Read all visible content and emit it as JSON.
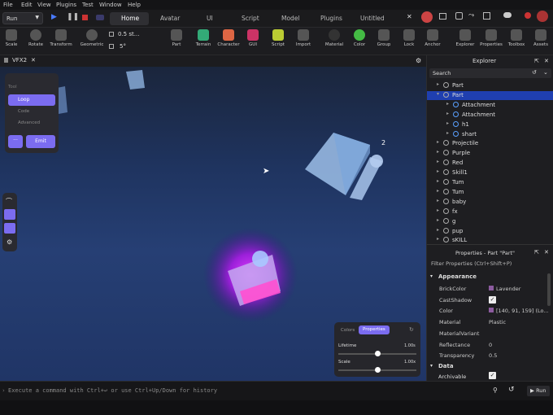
{
  "menu": [
    "File",
    "Edit",
    "View",
    "Plugins",
    "Test",
    "Window",
    "Help"
  ],
  "run_label": "Run",
  "tabs": [
    "Home",
    "Avatar",
    "UI",
    "Script",
    "Model",
    "Plugins",
    "Untitled"
  ],
  "ribbon": {
    "scale": "Scale",
    "rotate": "Rotate",
    "transform": "Transform",
    "geometric": "Geometric",
    "step": "0.5 st...",
    "angle": "5°",
    "part": "Part",
    "terrain": "Terrain",
    "character": "Character",
    "gui": "GUI",
    "script": "Script",
    "import": "Import",
    "material": "Material",
    "color": "Color",
    "group": "Group",
    "lock": "Lock",
    "anchor": "Anchor",
    "explorer": "Explorer",
    "properties": "Properties",
    "toolbox": "Toolbox",
    "assets": "Assets"
  },
  "viewport_tab": "VFX2",
  "vfx_panel": {
    "tool": "Tool",
    "loop": "Loop",
    "code": "Code",
    "advanced": "Advanced",
    "emit": "Emit",
    "more": "···"
  },
  "part_label": "2",
  "props_overlay": {
    "colors": "Colors",
    "properties": "Properties",
    "lifetime": "Lifetime",
    "lifetime_val": "1.00s",
    "scale": "Scale",
    "scale_val": "1.00x"
  },
  "explorer": {
    "title": "Explorer",
    "search": "Search",
    "items": [
      {
        "label": "Part",
        "depth": 1,
        "sel": false
      },
      {
        "label": "Part",
        "depth": 1,
        "sel": true
      },
      {
        "label": "Attachment",
        "depth": 2,
        "sel": false
      },
      {
        "label": "Attachment",
        "depth": 2,
        "sel": false
      },
      {
        "label": "h1",
        "depth": 2,
        "sel": false
      },
      {
        "label": "shart",
        "depth": 2,
        "sel": false
      },
      {
        "label": "Projectile",
        "depth": 1,
        "sel": false
      },
      {
        "label": "Purple",
        "depth": 1,
        "sel": false
      },
      {
        "label": "Red",
        "depth": 1,
        "sel": false
      },
      {
        "label": "Skill1",
        "depth": 1,
        "sel": false
      },
      {
        "label": "Tum",
        "depth": 1,
        "sel": false
      },
      {
        "label": "Tum",
        "depth": 1,
        "sel": false
      },
      {
        "label": "baby",
        "depth": 1,
        "sel": false
      },
      {
        "label": "fx",
        "depth": 1,
        "sel": false
      },
      {
        "label": "g",
        "depth": 1,
        "sel": false
      },
      {
        "label": "pup",
        "depth": 1,
        "sel": false
      },
      {
        "label": "sKILL",
        "depth": 1,
        "sel": false
      }
    ]
  },
  "properties": {
    "title": "Properties - Part \"Part\"",
    "filter": "Filter Properties (Ctrl+Shift+P)",
    "appearance": "Appearance",
    "rows": [
      {
        "k": "BrickColor",
        "v": "Lavender"
      },
      {
        "k": "CastShadow",
        "v": "✓"
      },
      {
        "k": "Color",
        "v": "[140, 91, 159] (Lo..."
      },
      {
        "k": "Material",
        "v": "Plastic"
      },
      {
        "k": "MaterialVariant",
        "v": ""
      },
      {
        "k": "Reflectance",
        "v": "0"
      },
      {
        "k": "Transparency",
        "v": "0.5"
      }
    ],
    "data": "Data",
    "archivable": "Archivable"
  },
  "command": {
    "placeholder": "Execute a command with Ctrl+↩ or use Ctrl+Up/Down for history",
    "run": "Run"
  }
}
